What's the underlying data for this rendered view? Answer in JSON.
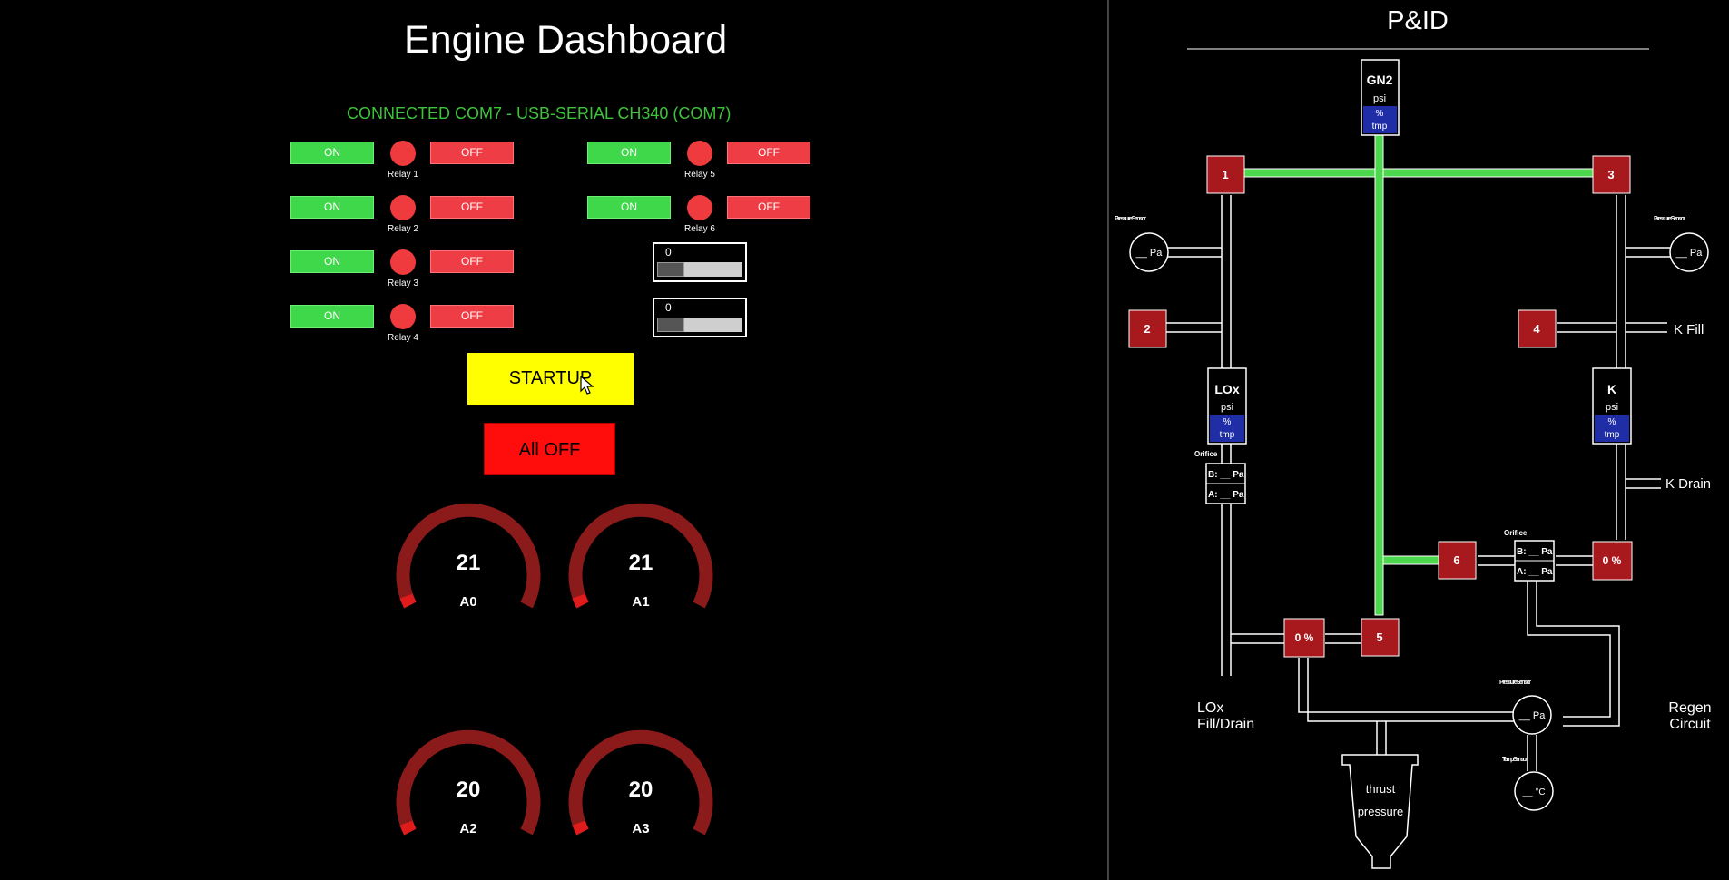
{
  "dashboard": {
    "title": "Engine Dashboard",
    "status": "CONNECTED COM7 - USB-SERIAL CH340 (COM7)",
    "status_color": "#3ec43a",
    "on_label": "ON",
    "off_label": "OFF",
    "relays": [
      "Relay 1",
      "Relay 2",
      "Relay 3",
      "Relay 4",
      "Relay 5",
      "Relay 6"
    ],
    "sliders": [
      {
        "value": "0"
      },
      {
        "value": "0"
      }
    ],
    "startup_label": "STARTUP",
    "alloff_label": "All OFF",
    "gauges": [
      {
        "label": "A0",
        "value": "21"
      },
      {
        "label": "A1",
        "value": "21"
      },
      {
        "label": "A2",
        "value": "20"
      },
      {
        "label": "A3",
        "value": "20"
      }
    ],
    "gauge_color": "#8b1a1a",
    "accent_red": "#e01b1b"
  },
  "pid": {
    "title": "P&ID",
    "valves": [
      "1",
      "2",
      "3",
      "4",
      "5",
      "6"
    ],
    "valve_pct_left": "0 %",
    "valve_pct_right": "0 %",
    "tanks": {
      "gn2": {
        "name": "GN2",
        "psi": "psi",
        "pct": "%",
        "tmp": "tmp"
      },
      "lox": {
        "name": "LOx",
        "psi": "psi",
        "pct": "%",
        "tmp": "tmp"
      },
      "k": {
        "name": "K",
        "psi": "psi",
        "pct": "%",
        "tmp": "tmp"
      }
    },
    "pressure_sensor_label": "Pressure Sensor",
    "pressure_reading": "__ Pa",
    "temp_sensor_label": "Temp Sensor",
    "temp_reading": "__ °C",
    "orifice_label": "Orifice",
    "orifice_b": "B: __ Pa",
    "orifice_a": "A: __ Pa",
    "k_fill": "K Fill",
    "k_drain": "K Drain",
    "lox_fill_drain_1": "LOx",
    "lox_fill_drain_2": "Fill/Drain",
    "regen_1": "Regen",
    "regen_2": "Circuit",
    "thrust_1": "thrust",
    "thrust_2": "pressure",
    "line_color": "#4cd84c",
    "valve_color": "#a8191e",
    "tank_fill": "#1f2ea6"
  }
}
